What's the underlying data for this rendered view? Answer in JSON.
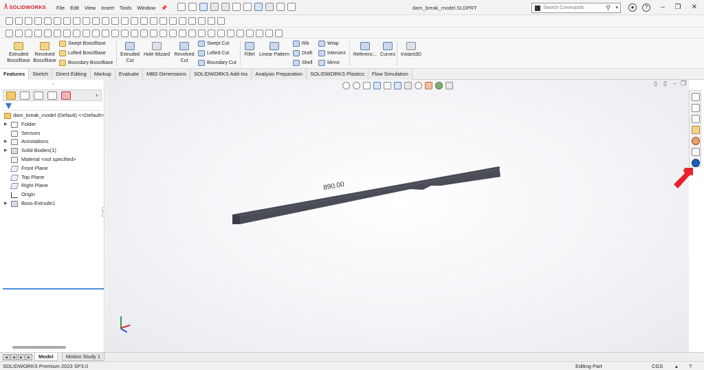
{
  "app": {
    "logo_text": "SOLIDWORKS",
    "menu": [
      "File",
      "Edit",
      "View",
      "Insert",
      "Tools",
      "Window"
    ],
    "document_title": "dam_break_model.SLDPRT",
    "search_placeholder": "Search Commands",
    "window_buttons": {
      "minimize": "–",
      "restore": "❐",
      "close": "✕"
    },
    "help_glyph": "?",
    "user_glyph": "●"
  },
  "command_manager": {
    "extruded_boss": "Extruded Boss/Base",
    "revolved_boss": "Revolved Boss/Base",
    "swept_boss": "Swept Boss/Base",
    "lofted_boss": "Lofted Boss/Base",
    "boundary_boss": "Boundary Boss/Base",
    "extruded_cut": "Extruded Cut",
    "hole_wizard": "Hole Wizard",
    "revolved_cut": "Revolved Cut",
    "swept_cut": "Swept Cut",
    "lofted_cut": "Lofted Cut",
    "boundary_cut": "Boundary Cut",
    "fillet": "Fillet",
    "linear_pattern": "Linear Pattern",
    "rib": "Rib",
    "draft": "Draft",
    "shell": "Shell",
    "wrap": "Wrap",
    "intersect": "Intersect",
    "mirror": "Mirror",
    "reference": "Referenc...",
    "curves": "Curves",
    "instant3d": "Instant3D"
  },
  "tabs": [
    "Features",
    "Sketch",
    "Direct Editing",
    "Markup",
    "Evaluate",
    "MBD Dimensions",
    "SOLIDWORKS Add-Ins",
    "Analysis Preparation",
    "SOLIDWORKS Plastics",
    "Flow Simulation"
  ],
  "feature_tree": {
    "root": "dam_break_model (Default) <<Default>",
    "items": [
      {
        "label": "Folder",
        "expandable": true,
        "icon": "folder-icon"
      },
      {
        "label": "Sensors",
        "expandable": false,
        "icon": "sensor-icon"
      },
      {
        "label": "Annotations",
        "expandable": true,
        "icon": "annotation-icon"
      },
      {
        "label": "Solid Bodies(1)",
        "expandable": true,
        "icon": "solid-bodies-icon"
      },
      {
        "label": "Material <not specified>",
        "expandable": false,
        "icon": "material-icon"
      },
      {
        "label": "Front Plane",
        "expandable": false,
        "icon": "plane-icon"
      },
      {
        "label": "Top Plane",
        "expandable": false,
        "icon": "plane-icon"
      },
      {
        "label": "Right Plane",
        "expandable": false,
        "icon": "plane-icon"
      },
      {
        "label": "Origin",
        "expandable": false,
        "icon": "origin-icon"
      },
      {
        "label": "Boss-Extrude1",
        "expandable": true,
        "icon": "extrude-feature-icon"
      }
    ]
  },
  "model": {
    "dimension_label": "890.00"
  },
  "bottom_tabs": [
    "Model",
    "Motion Study 1"
  ],
  "status_bar": {
    "product": "SOLIDWORKS Premium 2023 SP3.0",
    "mode": "Editing Part",
    "units": "CGS"
  },
  "colors": {
    "brand_red": "#d6202a",
    "model_face": "#4a4d57",
    "model_top": "#6b6e78",
    "annotation_arrow": "#e8202a",
    "rollback_bar": "#4a90d9"
  }
}
